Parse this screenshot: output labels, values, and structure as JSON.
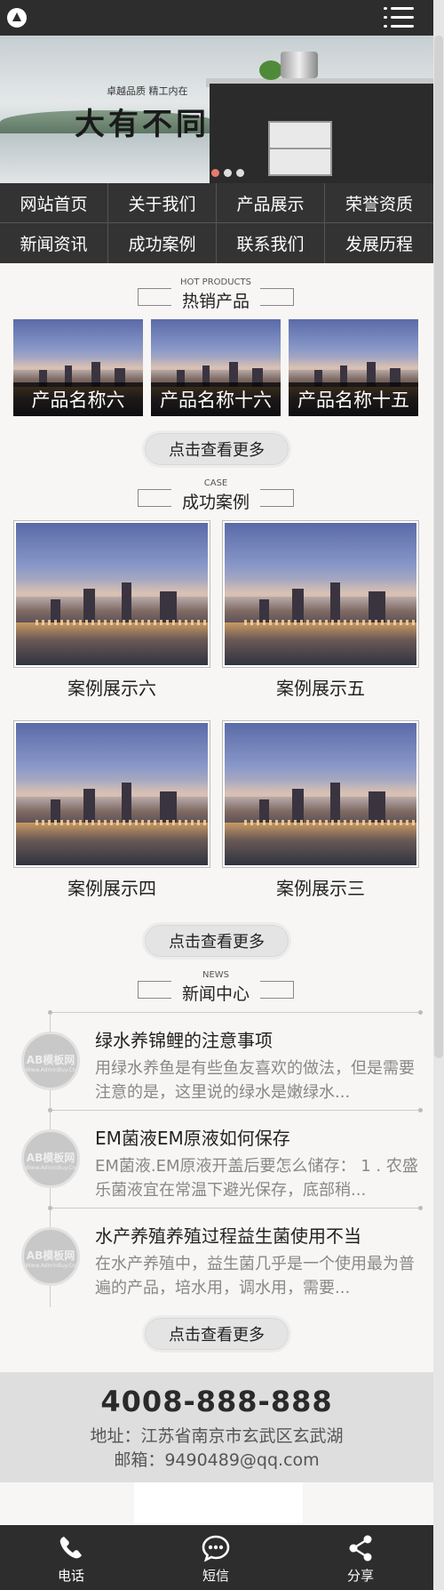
{
  "header": {
    "logo_icon": "logo-icon",
    "menu_icon": "hamburger-menu-icon"
  },
  "banner": {
    "tagline": "卓越品质 精工内在",
    "slogan": "大有不同",
    "slide_count": 3,
    "active_slide": 1
  },
  "nav": {
    "items": [
      "网站首页",
      "关于我们",
      "产品展示",
      "荣誉资质",
      "新闻资讯",
      "成功案例",
      "联系我们",
      "发展历程"
    ]
  },
  "products": {
    "title_en": "HOT PRODUCTS",
    "title_cn": "热销产品",
    "items": [
      "产品名称六",
      "产品名称十六",
      "产品名称十五"
    ],
    "more_label": "点击查看更多"
  },
  "cases": {
    "title_en": "CASE",
    "title_cn": "成功案例",
    "items": [
      "案例展示六",
      "案例展示五",
      "案例展示四",
      "案例展示三"
    ],
    "more_label": "点击查看更多"
  },
  "news": {
    "title_en": "NEWS",
    "title_cn": "新闻中心",
    "avatar_text": "AB模板网",
    "avatar_sub": "Www.AdminBuy.Cn",
    "items": [
      {
        "title": "绿水养锦鲤的注意事项",
        "desc": "用绿水养鱼是有些鱼友喜欢的做法，但是需要注意的是，这里说的绿水是嫩绿水..."
      },
      {
        "title": "EM菌液EM原液如何保存",
        "desc": "EM菌液.EM原液开盖后要怎么储存： 1 . 农盛乐菌液宜在常温下避光保存，底部稍..."
      },
      {
        "title": "水产养殖养殖过程益生菌使用不当",
        "desc": "在水产养殖中，益生菌几乎是一个使用最为普遍的产品，培水用，调水用，需要..."
      }
    ],
    "more_label": "点击查看更多"
  },
  "footer": {
    "phone": "4008-888-888",
    "address": "地址：江苏省南京市玄武区玄武湖",
    "email": "邮箱：9490489@qq.com"
  },
  "bottom_bar": {
    "items": [
      {
        "label": "电话",
        "icon": "phone-icon"
      },
      {
        "label": "短信",
        "icon": "message-icon"
      },
      {
        "label": "分享",
        "icon": "share-icon"
      }
    ]
  },
  "colors": {
    "dark": "#2d2d2d",
    "nav_bg": "#333333",
    "footer_bg": "#dedede",
    "muted_text": "#888888"
  }
}
